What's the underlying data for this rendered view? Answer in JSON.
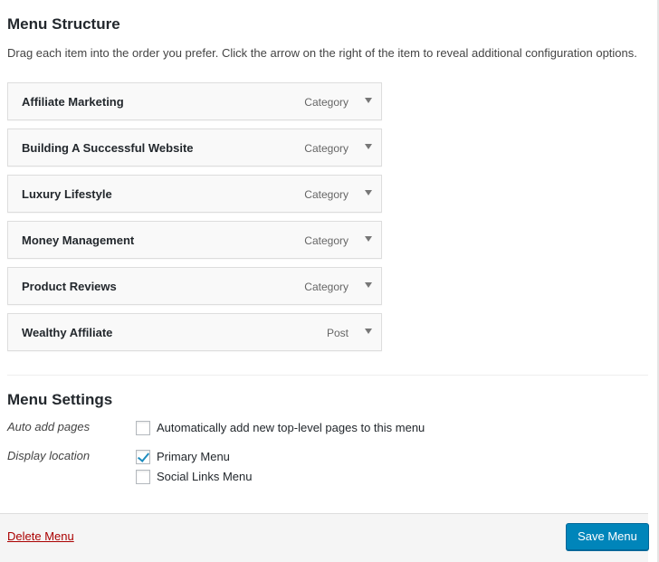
{
  "structure": {
    "title": "Menu Structure",
    "instructions": "Drag each item into the order you prefer. Click the arrow on the right of the item to reveal additional configuration options."
  },
  "items": [
    {
      "title": "Affiliate Marketing",
      "type": "Category"
    },
    {
      "title": "Building A Successful Website",
      "type": "Category"
    },
    {
      "title": "Luxury Lifestyle",
      "type": "Category"
    },
    {
      "title": "Money Management",
      "type": "Category"
    },
    {
      "title": "Product Reviews",
      "type": "Category"
    },
    {
      "title": "Wealthy Affiliate",
      "type": "Post"
    }
  ],
  "settings": {
    "title": "Menu Settings",
    "auto_add": {
      "label": "Auto add pages",
      "option": "Automatically add new top-level pages to this menu",
      "checked": false
    },
    "display_location": {
      "label": "Display location",
      "options": [
        {
          "label": "Primary Menu",
          "checked": true
        },
        {
          "label": "Social Links Menu",
          "checked": false
        }
      ]
    }
  },
  "footer": {
    "delete_label": "Delete Menu",
    "save_label": "Save Menu"
  },
  "colors": {
    "primary_button": "#0085ba",
    "delete_link": "#aa0000",
    "checkmark": "#1e8cbe"
  }
}
